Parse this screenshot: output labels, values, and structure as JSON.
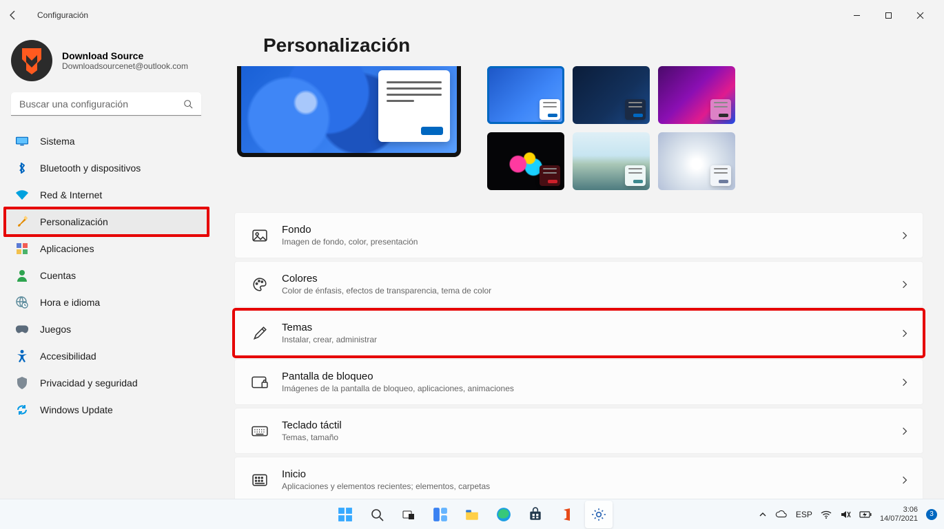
{
  "window": {
    "app_name": "Configuración"
  },
  "user": {
    "name": "Download Source",
    "email": "Downloadsourcenet@outlook.com"
  },
  "search": {
    "placeholder": "Buscar una configuración"
  },
  "sidebar": {
    "items": [
      {
        "id": "system",
        "label": "Sistema",
        "icon": "monitor-icon",
        "color": "#0067c0"
      },
      {
        "id": "bluetooth",
        "label": "Bluetooth y dispositivos",
        "icon": "bluetooth-icon",
        "color": "#0067c0"
      },
      {
        "id": "network",
        "label": "Red & Internet",
        "icon": "wifi-icon",
        "color": "#00a1de"
      },
      {
        "id": "personal",
        "label": "Personalización",
        "icon": "paintbrush-icon",
        "color": "#e38b00",
        "active": true,
        "highlighted": true
      },
      {
        "id": "apps",
        "label": "Aplicaciones",
        "icon": "apps-icon",
        "color": "#5b7bd5"
      },
      {
        "id": "accounts",
        "label": "Cuentas",
        "icon": "person-icon",
        "color": "#2ea44f"
      },
      {
        "id": "time",
        "label": "Hora e idioma",
        "icon": "globe-clock-icon",
        "color": "#5b8a9b"
      },
      {
        "id": "gaming",
        "label": "Juegos",
        "icon": "gamepad-icon",
        "color": "#5b6b7b"
      },
      {
        "id": "access",
        "label": "Accesibilidad",
        "icon": "accessibility-icon",
        "color": "#0067c0"
      },
      {
        "id": "privacy",
        "label": "Privacidad y seguridad",
        "icon": "shield-icon",
        "color": "#7e8a95"
      },
      {
        "id": "update",
        "label": "Windows Update",
        "icon": "update-icon",
        "color": "#0099e5"
      }
    ]
  },
  "page": {
    "title": "Personalización",
    "theme_thumbs": [
      "t1",
      "t2",
      "t3",
      "t4",
      "t5",
      "t6"
    ],
    "selected_theme_index": 0,
    "settings": [
      {
        "id": "background",
        "title": "Fondo",
        "desc": "Imagen de fondo, color, presentación",
        "icon": "image-icon"
      },
      {
        "id": "colors",
        "title": "Colores",
        "desc": "Color de énfasis, efectos de transparencia, tema de color",
        "icon": "palette-icon"
      },
      {
        "id": "themes",
        "title": "Temas",
        "desc": "Instalar, crear, administrar",
        "icon": "pen-icon",
        "highlighted": true
      },
      {
        "id": "lock",
        "title": "Pantalla de bloqueo",
        "desc": "Imágenes de la pantalla de bloqueo, aplicaciones, animaciones",
        "icon": "lockscreen-icon"
      },
      {
        "id": "touchkbd",
        "title": "Teclado táctil",
        "desc": "Temas, tamaño",
        "icon": "keyboard-icon"
      },
      {
        "id": "start",
        "title": "Inicio",
        "desc": "Aplicaciones y elementos recientes; elementos, carpetas",
        "icon": "start-icon"
      }
    ]
  },
  "taskbar": {
    "lang": "ESP",
    "time": "3:06",
    "date": "14/07/2021",
    "notification_count": "3"
  }
}
